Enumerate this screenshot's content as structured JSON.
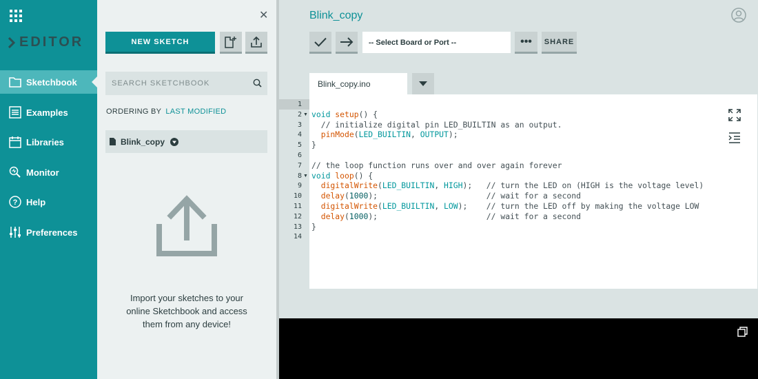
{
  "brand": {
    "name": "EDITOR"
  },
  "nav": {
    "items": [
      {
        "label": "Sketchbook",
        "icon": "folder-icon",
        "active": true
      },
      {
        "label": "Examples",
        "icon": "list-icon"
      },
      {
        "label": "Libraries",
        "icon": "library-icon"
      },
      {
        "label": "Monitor",
        "icon": "monitor-icon"
      },
      {
        "label": "Help",
        "icon": "help-icon"
      },
      {
        "label": "Preferences",
        "icon": "sliders-icon"
      }
    ]
  },
  "sketchbook": {
    "new_sketch_label": "NEW SKETCH",
    "search_placeholder": "SEARCH SKETCHBOOK",
    "ordering_label": "ORDERING BY",
    "ordering_value": "LAST MODIFIED",
    "sketches": [
      {
        "name": "Blink_copy"
      }
    ],
    "import_text": "Import your sketches to your online Sketchbook and access them from any device!"
  },
  "editor": {
    "sketch_title": "Blink_copy",
    "board_select": "-- Select Board or Port --",
    "more_label": "•••",
    "share_label": "SHARE",
    "tab_label": "Blink_copy.ino",
    "code_lines": [
      "",
      "void setup() {",
      "  // initialize digital pin LED_BUILTIN as an output.",
      "  pinMode(LED_BUILTIN, OUTPUT);",
      "}",
      "",
      "// the loop function runs over and over again forever",
      "void loop() {",
      "  digitalWrite(LED_BUILTIN, HIGH);   // turn the LED on (HIGH is the voltage level)",
      "  delay(1000);                       // wait for a second",
      "  digitalWrite(LED_BUILTIN, LOW);    // turn the LED off by making the voltage LOW",
      "  delay(1000);                       // wait for a second",
      "}",
      ""
    ],
    "line_numbers": [
      "1",
      "2",
      "3",
      "4",
      "5",
      "6",
      "7",
      "8",
      "9",
      "10",
      "11",
      "12",
      "13",
      "14"
    ]
  },
  "colors": {
    "teal": "#0e9197",
    "nav_active": "#4db7bb",
    "panel_bg": "#ecf1f1",
    "editor_bg": "#dae3e3"
  }
}
